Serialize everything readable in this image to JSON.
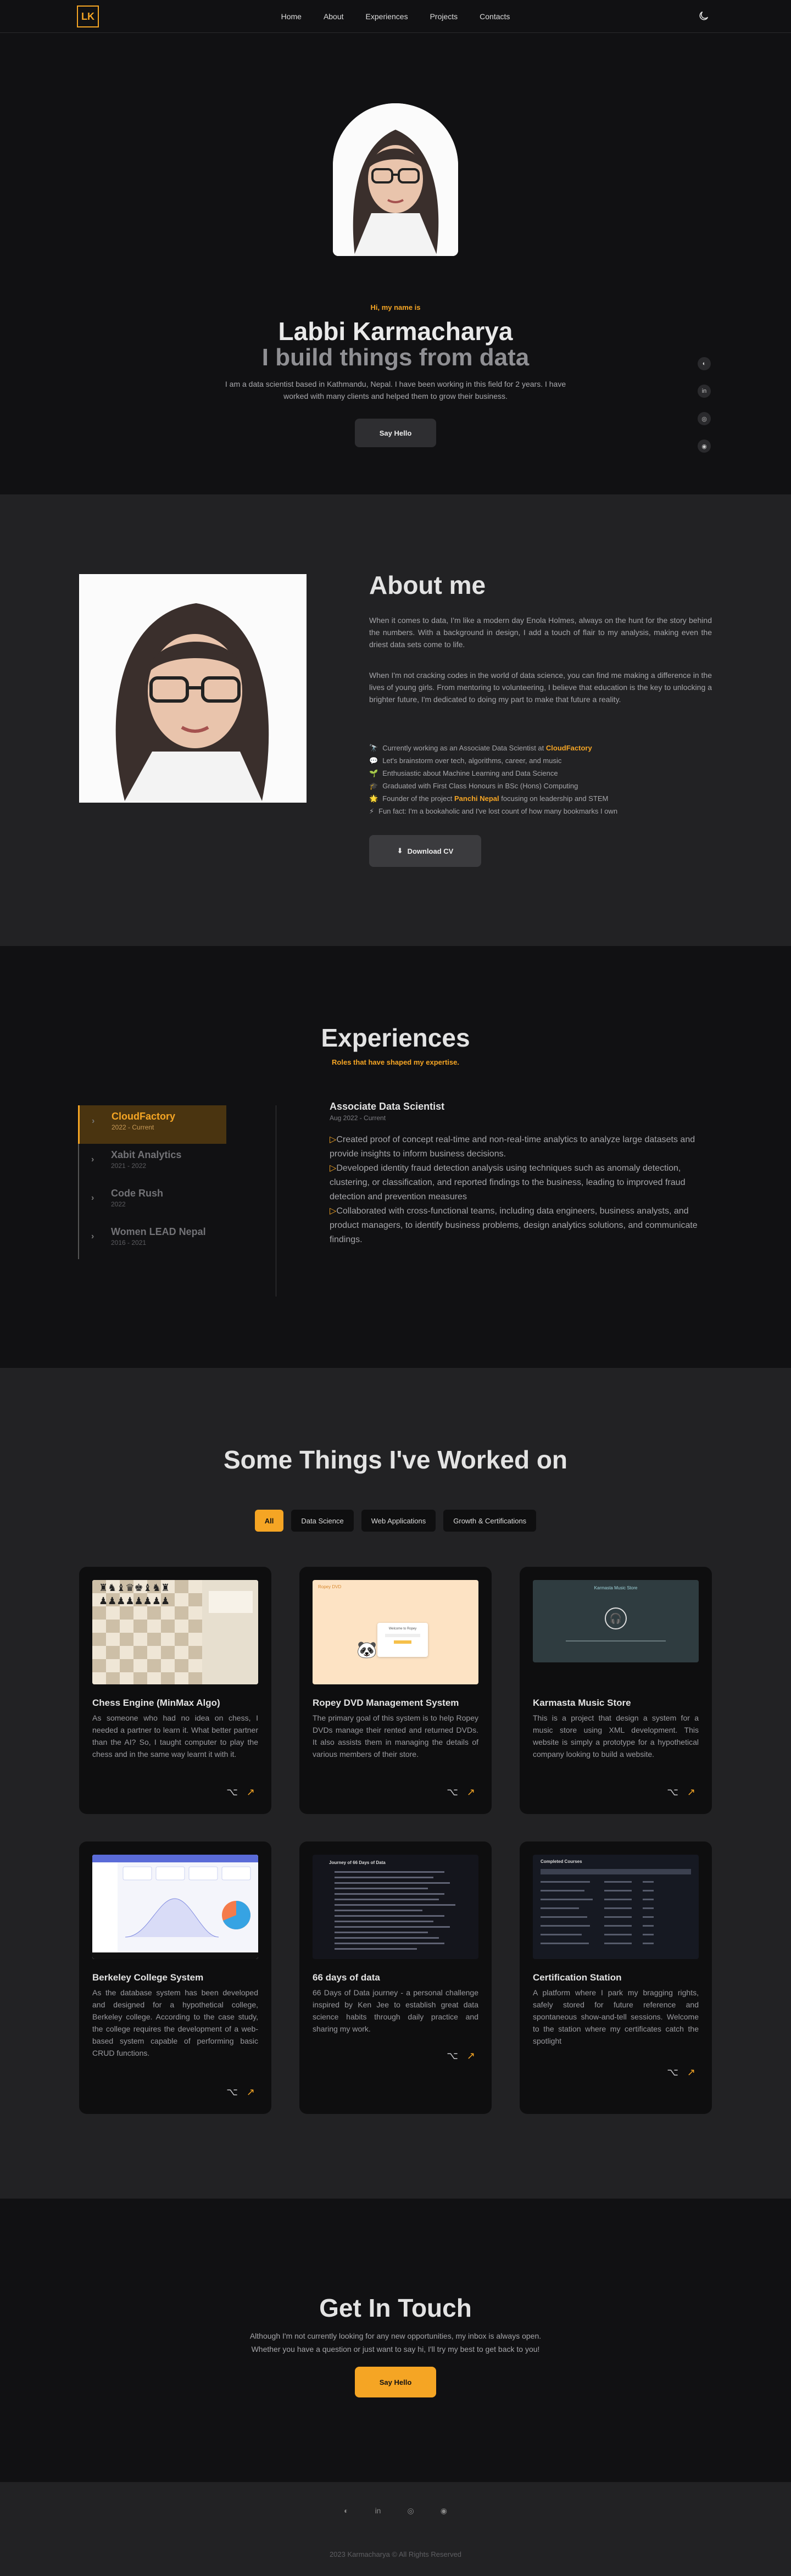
{
  "nav": {
    "logo": "LK",
    "links": [
      "Home",
      "About",
      "Experiences",
      "Projects",
      "Contacts"
    ],
    "theme_icon": "moon-icon"
  },
  "hero": {
    "greeting": "Hi, my name is",
    "name": "Labbi Karmacharya",
    "tagline": "I build things from data",
    "intro": "I am a data scientist based in Kathmandu, Nepal. I have been working in this field for 2 years. I have worked with many clients and helped them to grow their business.",
    "cta": "Say Hello",
    "social_icons": [
      "github-icon",
      "linkedin-icon",
      "instagram-icon",
      "discord-icon"
    ]
  },
  "about": {
    "heading": "About me",
    "para1": "When it comes to data, I'm like a modern day Enola Holmes, always on the hunt for the story behind the numbers. With a background in design, I add a touch of flair to my analysis, making even the driest data sets come to life.",
    "para2": "When I'm not cracking codes in the world of data science, you can find me making a difference in the lives of young girls. From mentoring to volunteering, I believe that education is the key to unlocking a brighter future, I'm dedicated to doing my part to make that future a reality.",
    "facts": [
      {
        "icon": "🔭",
        "pre": "Currently working as an Associate Data Scientist at ",
        "em": "CloudFactory",
        "post": ""
      },
      {
        "icon": "💬",
        "pre": "Let's brainstorm over tech, algorithms, career, and music",
        "em": "",
        "post": ""
      },
      {
        "icon": "🌱",
        "pre": "Enthusiastic about Machine Learning and Data Science",
        "em": "",
        "post": ""
      },
      {
        "icon": "🎓",
        "pre": "Graduated with First Class Honours in BSc (Hons) Computing",
        "em": "",
        "post": ""
      },
      {
        "icon": "🌟",
        "pre": "Founder of the project ",
        "em": "Panchi Nepal",
        "post": " focusing on leadership and STEM"
      },
      {
        "icon": "⚡",
        "pre": "Fun fact: I'm a bookaholic and I've lost count of how many bookmarks I own",
        "em": "",
        "post": ""
      }
    ],
    "cv_button": "Download CV"
  },
  "experiences": {
    "heading": "Experiences",
    "subheading": "Roles that have shaped my expertise.",
    "tabs": [
      {
        "company": "CloudFactory",
        "years": "2022 - Current"
      },
      {
        "company": "Xabit Analytics",
        "years": "2021 - 2022"
      },
      {
        "company": "Code Rush",
        "years": "2022"
      },
      {
        "company": "Women LEAD Nepal",
        "years": "2016 - 2021"
      }
    ],
    "role": "Associate Data Scientist",
    "period": "Aug 2022 - Current",
    "bullets": [
      "Created proof of concept real-time and non-real-time analytics to analyze large datasets and provide insights to inform business decisions.",
      "Developed identity fraud detection analysis using techniques such as anomaly detection, clustering, or classification, and reported findings to the business, leading to improved fraud detection and prevention measures",
      "Collaborated with cross-functional teams, including data engineers, business analysts, and product managers, to identify business problems, design analytics solutions, and communicate findings."
    ]
  },
  "projects": {
    "heading": "Some Things I've Worked on",
    "filters": [
      "All",
      "Data Science",
      "Web Applications",
      "Growth & Certifications"
    ],
    "cards": [
      {
        "title": "Chess Engine (MinMax Algo)",
        "desc": "As someone who had no idea on chess, I needed a partner to learn it. What better partner than the AI? So, I taught computer to play the chess and in the same way learnt it with it."
      },
      {
        "title": "Ropey DVD Management System",
        "desc": "The primary goal of this system is to help Ropey DVDs manage their rented and returned DVDs. It also assists them in managing the details of various members of their store.",
        "thumb_label": "Ropey DVD",
        "thumb_panel": "Welcome to Ropey"
      },
      {
        "title": "Karmasta Music Store",
        "desc": "This is a project that design a system for a music store using XML development. This website is simply a prototype for a hypothetical company looking to build a website.",
        "thumb_label": "Karmasta Music Store"
      },
      {
        "title": "Berkeley College System",
        "desc": "As the database system has been developed and designed for a hypothetical college, Berkeley college. According to the case study, the college requires the development of a web-based system capable of performing basic CRUD functions."
      },
      {
        "title": "66 days of data",
        "desc": "66 Days of Data journey - a personal challenge inspired by Ken Jee to establish great data science habits through daily practice and sharing my work.",
        "thumb_label": "Journey of 66 Days of Data"
      },
      {
        "title": "Certification Station",
        "desc": "A platform where I park my bragging rights, safely stored for future reference and spontaneous show-and-tell sessions. Welcome to the station where my certificates catch the spotlight",
        "thumb_label": "Completed Courses"
      }
    ]
  },
  "contact": {
    "heading": "Get In Touch",
    "line1": "Although I'm not currently looking for any new opportunities, my inbox is always open.",
    "line2": "Whether you have a question or just want to say hi, I'll try my best to get back to you!",
    "cta": "Say Hello"
  },
  "footer": {
    "social_icons": [
      "github-icon",
      "linkedin-icon",
      "instagram-icon",
      "discord-icon"
    ],
    "copyright": "2023 Karmacharya © All Rights Reserved"
  },
  "colors": {
    "accent": "#f5a524",
    "bg_dark": "#111113",
    "bg_mid": "#222224"
  }
}
